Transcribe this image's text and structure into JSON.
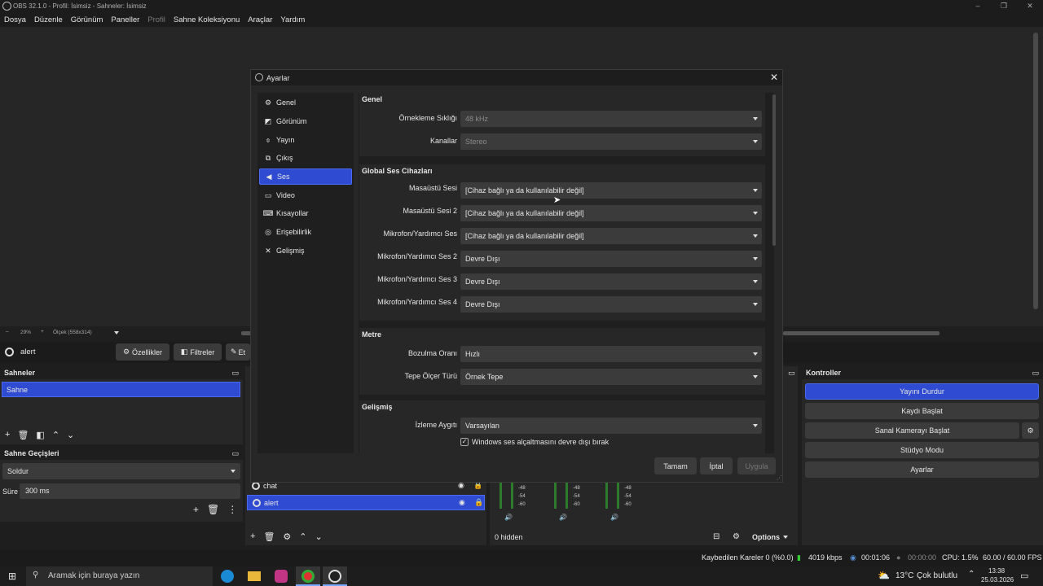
{
  "window": {
    "title": "OBS 32.1.0 - Profil: İsimsiz - Sahneler: İsimsiz",
    "controls": [
      "–",
      "❐",
      "✕"
    ]
  },
  "menu": [
    "Dosya",
    "Düzenle",
    "Görünüm",
    "Paneller",
    "Profil",
    "Sahne Koleksiyonu",
    "Araçlar",
    "Yardım"
  ],
  "zoom": {
    "minus": "–",
    "value": "29%",
    "plus": "+",
    "scale": "Ölçek (558x314)"
  },
  "source_bar": {
    "name": "alert",
    "properties": "Özellikler",
    "filters": "Filtreler",
    "effects": "Et"
  },
  "scenes": {
    "title": "Sahneler",
    "items": [
      "Sahne"
    ]
  },
  "transitions": {
    "title": "Sahne Geçişleri",
    "selected": "Soldur",
    "duration_label": "Süre",
    "duration_value": "300 ms"
  },
  "sources": {
    "items": [
      {
        "name": "chat"
      },
      {
        "name": "alert"
      }
    ]
  },
  "mixer": {
    "hidden": "0 hidden",
    "ticks": [
      "-48",
      "-54",
      "-60"
    ],
    "options": "Options"
  },
  "controls": {
    "title": "Kontroller",
    "stop_stream": "Yayını Durdur",
    "start_record": "Kaydı Başlat",
    "virtual_cam": "Sanal Kamerayı Başlat",
    "studio_mode": "Stüdyo Modu",
    "settings": "Ayarlar"
  },
  "status": {
    "dropped": "Kaybedilen Kareler 0 (%0.0)",
    "bitrate": "4019 kbps",
    "stream_time": "00:01:06",
    "rec_time": "00:00:00",
    "cpu": "CPU: 1.5%",
    "fps": "60.00 / 60.00 FPS"
  },
  "taskbar": {
    "search": "Aramak için buraya yazın",
    "weather": "13°C",
    "weather_desc": "Çok bulutlu",
    "time": "13:38",
    "date": "25.03.2026"
  },
  "dialog": {
    "title": "Ayarlar",
    "sidebar": [
      {
        "label": "Genel",
        "icon": "gear-icon"
      },
      {
        "label": "Görünüm",
        "icon": "palette-icon"
      },
      {
        "label": "Yayın",
        "icon": "broadcast-icon"
      },
      {
        "label": "Çıkış",
        "icon": "output-icon"
      },
      {
        "label": "Ses",
        "icon": "speaker-icon"
      },
      {
        "label": "Video",
        "icon": "monitor-icon"
      },
      {
        "label": "Kısayollar",
        "icon": "keyboard-icon"
      },
      {
        "label": "Erişebilirlik",
        "icon": "accessibility-icon"
      },
      {
        "label": "Gelişmiş",
        "icon": "wrench-icon"
      }
    ],
    "selected_index": 4,
    "general": {
      "title": "Genel",
      "sample_rate_label": "Örnekleme Sıklığı",
      "sample_rate": "48 kHz",
      "channels_label": "Kanallar",
      "channels": "Stereo"
    },
    "devices": {
      "title": "Global Ses Cihazları",
      "rows": [
        {
          "label": "Masaüstü Sesi",
          "value": "[Cihaz bağlı ya da kullanılabilir değil]"
        },
        {
          "label": "Masaüstü Sesi 2",
          "value": "[Cihaz bağlı ya da kullanılabilir değil]"
        },
        {
          "label": "Mikrofon/Yardımcı Ses",
          "value": "[Cihaz bağlı ya da kullanılabilir değil]"
        },
        {
          "label": "Mikrofon/Yardımcı Ses 2",
          "value": "Devre Dışı"
        },
        {
          "label": "Mikrofon/Yardımcı Ses 3",
          "value": "Devre Dışı"
        },
        {
          "label": "Mikrofon/Yardımcı Ses 4",
          "value": "Devre Dışı"
        }
      ]
    },
    "meters": {
      "title": "Metre",
      "decay_label": "Bozulma Oranı",
      "decay": "Hızlı",
      "peak_label": "Tepe Ölçer Türü",
      "peak": "Örnek Tepe"
    },
    "advanced": {
      "title": "Gelişmiş",
      "monitor_label": "İzleme Aygıtı",
      "monitor": "Varsayılan",
      "ducking_label": "Windows ses alçaltmasını devre dışı bırak",
      "ducking_checked": true
    },
    "buttons": {
      "ok": "Tamam",
      "cancel": "İptal",
      "apply": "Uygula"
    }
  }
}
